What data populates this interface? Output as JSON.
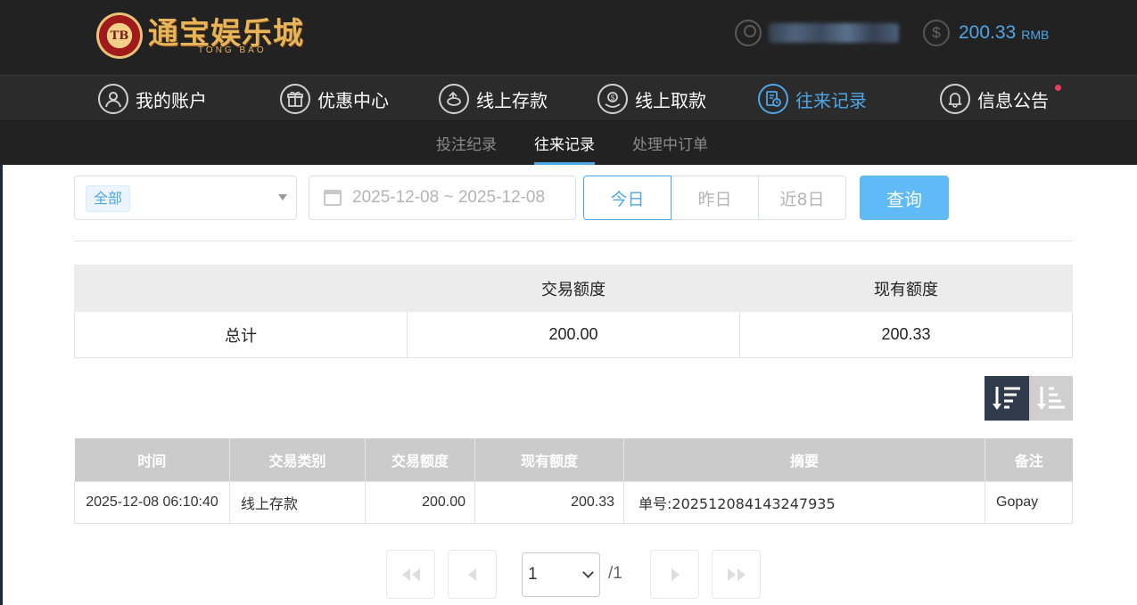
{
  "header": {
    "logo_badge": "TB",
    "logo_text_cn": "通宝娱乐城",
    "logo_text_en": "TONG BAO",
    "balance_value": "200.33",
    "balance_unit": "RMB",
    "coin_symbol": "$"
  },
  "mainnav": {
    "items": [
      {
        "label": "我的账户",
        "icon": "user-icon",
        "active": false
      },
      {
        "label": "优惠中心",
        "icon": "gift-icon",
        "active": false
      },
      {
        "label": "线上存款",
        "icon": "deposit-icon",
        "active": false
      },
      {
        "label": "线上取款",
        "icon": "withdraw-icon",
        "active": false
      },
      {
        "label": "往来记录",
        "icon": "records-icon",
        "active": true
      },
      {
        "label": "信息公告",
        "icon": "bell-icon",
        "active": false
      }
    ]
  },
  "subnav": {
    "items": [
      "投注纪录",
      "往来记录",
      "处理中订单"
    ],
    "active": "往来记录"
  },
  "filters": {
    "type_tag": "全部",
    "date_range": "2025-12-08 ~ 2025-12-08",
    "quick": [
      "今日",
      "昨日",
      "近8日"
    ],
    "query_label": "查询"
  },
  "summary": {
    "headers": [
      "",
      "交易额度",
      "现有额度"
    ],
    "row": {
      "label": "总计",
      "amount": "200.00",
      "balance": "200.33"
    }
  },
  "records": {
    "headers": [
      "时间",
      "交易类别",
      "交易额度",
      "现有额度",
      "摘要",
      "备注"
    ],
    "rows": [
      {
        "time": "2025-12-08 06:10:40",
        "type": "线上存款",
        "amount": "200.00",
        "balance": "200.33",
        "summary": "单号:202512084143247935",
        "note": "Gopay"
      }
    ]
  },
  "pagination": {
    "current_page": "1",
    "total_label": "/1"
  },
  "colors": {
    "accent": "#4fa6e6",
    "header_bg": "#222222",
    "nav_bg": "#2b2b2b",
    "query_button": "#5fbaf6",
    "notification_dot": "#ec3c5c"
  }
}
